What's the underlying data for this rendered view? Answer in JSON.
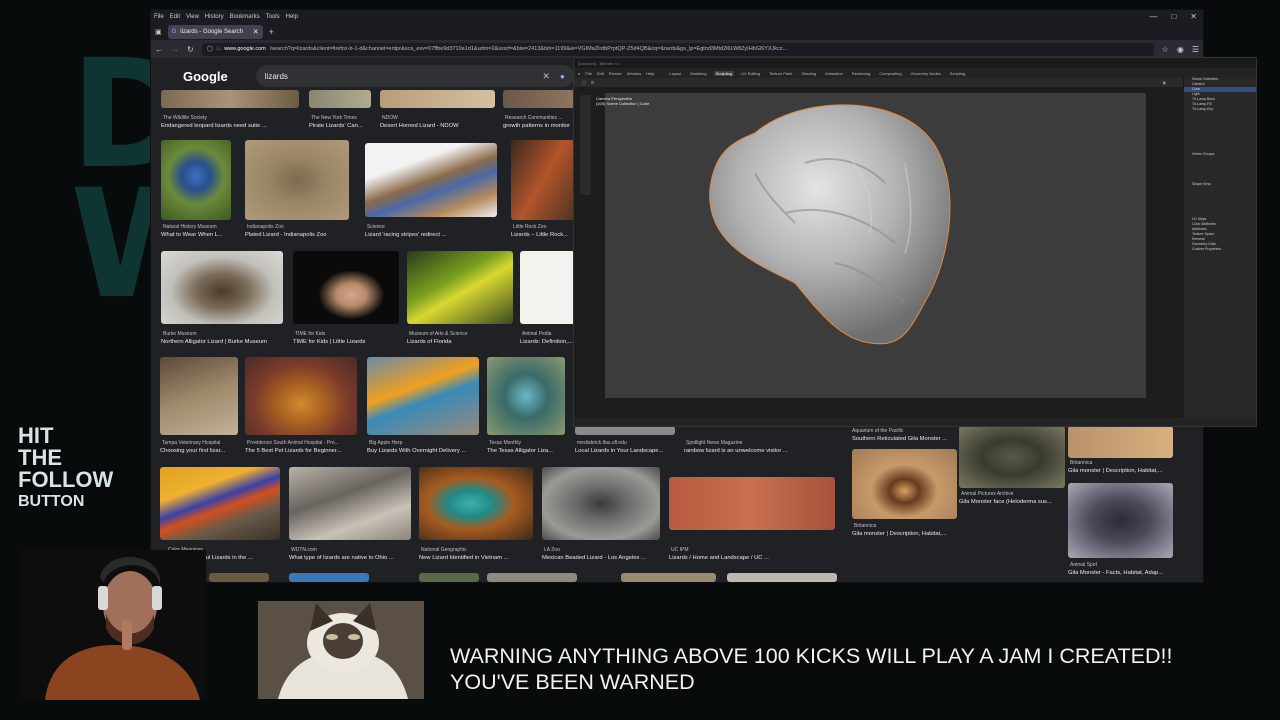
{
  "overlay": {
    "follow_lines": [
      "HIT",
      "THE",
      "FOLLOW",
      "BUTTON"
    ],
    "warning_line1": "WARNING ANYTHING ABOVE 100 KICKS WILL PLAY A JAM I CREATED!!",
    "warning_line2": "YOU'VE BEEN WARNED"
  },
  "browser": {
    "menu": [
      "File",
      "Edit",
      "View",
      "History",
      "Bookmarks",
      "Tools",
      "Help"
    ],
    "tab_label": "lizards - Google Search",
    "url_host": "www.google.com",
    "url_rest": "/search?q=lizards&client=firefox-b-1-d&channel=entpr&sca_esv=07ffbe9d3710a1d1&udm=2&sxsrf=&biw=2413&bih=1199&ei=VGtMaZlrdbPrptQP-Z5d4QB&oq=lizards&gs_lp=Egtnd3Mtd2l6LWltZyIHbGl6YXJkcz...",
    "search_query": "lizards",
    "logo": "Google"
  },
  "results": [
    {
      "source": "The Wildlife Society",
      "title": "Endangered leopard lizards need suite ..."
    },
    {
      "source": "The New York Times",
      "title": "Pirate Lizards' Can..."
    },
    {
      "source": "NDOW",
      "title": "Desert Horned Lizard - NDOW"
    },
    {
      "source": "Research Communities ...",
      "title": "growth patterns in monitor"
    },
    {
      "source": "Natural History Museum",
      "title": "What to Wear When L..."
    },
    {
      "source": "Indianapolis Zoo",
      "title": "Plated Lizard - Indianapolis Zoo"
    },
    {
      "source": "Science",
      "title": "Lizard 'racing stripes' redirect ..."
    },
    {
      "source": "Little Rock Zoo",
      "title": "Lizards – Little Rock..."
    },
    {
      "source": "Burke Museum",
      "title": "Northern Alligator Lizard | Burke Museum"
    },
    {
      "source": "TIME for Kids",
      "title": "TIME for Kids | Little Lizards"
    },
    {
      "source": "Museum of Arts & Science",
      "title": "Lizards of Florida"
    },
    {
      "source": "Animal Pedia",
      "title": "Lizards: Definition,..."
    },
    {
      "source": "Tampa Veterinary Hospital",
      "title": "Choosing your first lizar..."
    },
    {
      "source": "Providence South Animal Hospital - Pro...",
      "title": "The 5 Best Pet Lizards for Beginner..."
    },
    {
      "source": "Big Apple Herp",
      "title": "Buy Lizards With Overnight Delivery ..."
    },
    {
      "source": "Texas Monthly",
      "title": "The Texas Alligator Liza..."
    },
    {
      "source": "mediabrick.ifas.ufl.edu",
      "title": "Local Lizards in Your Landscape..."
    },
    {
      "source": "Spotlight News Magazine",
      "title": "rainbow lizard is an unwelcome visitor ..."
    },
    {
      "source": "Aquarium of the Pacific",
      "title": "Southern Reticulated Gila Monster ..."
    },
    {
      "source": "Britannica",
      "title": "Gila monster | Description, Habitat,..."
    },
    {
      "source": "Color Meanings",
      "title": "of the Most Colorful Lizards in the ..."
    },
    {
      "source": "WDTN.com",
      "title": "What type of lizards are native to Ohio ..."
    },
    {
      "source": "National Geographic",
      "title": "New Lizard Identified in Vietnam ..."
    },
    {
      "source": "LA Zoo",
      "title": "Mexican Beaded Lizard - Los Angeles ..."
    },
    {
      "source": "UC IPM",
      "title": "Lizards / Home and Landscape / UC ..."
    },
    {
      "source": "Animal Pictures Archive",
      "title": "Gila Monster face (Heloderma sus..."
    },
    {
      "source": "Britannica",
      "title": "Gila monster | Description, Habitat,..."
    },
    {
      "source": "Animal Spot",
      "title": "Gila Monster - Facts, Habitat, Adap..."
    }
  ],
  "blender": {
    "titlebar": "[Unsaved] - Blender 4.x",
    "menu": [
      "File",
      "Edit",
      "Render",
      "Window",
      "Help"
    ],
    "workspaces": [
      "Layout",
      "Modeling",
      "Sculpting",
      "UV Editing",
      "Texture Paint",
      "Shading",
      "Animation",
      "Rendering",
      "Compositing",
      "Geometry Nodes",
      "Scripting"
    ],
    "active_workspace": "Sculpting",
    "view_label": "Camera Perspective",
    "collection_label": "(100) Scene Collection | Cube",
    "outliner": [
      "Scene Collection",
      "Camera",
      "Cube",
      "Light",
      "Tri-Lamp-Back",
      "Tri-Lamp-Fill",
      "Tri-Lamp-Key"
    ],
    "properties": [
      "Vertex Groups",
      "Shape Keys",
      "UV Maps",
      "Color Attributes",
      "Attributes",
      "Texture Space",
      "Remesh",
      "Geometry Data",
      "Custom Properties"
    ]
  },
  "colors": {
    "accent": "#8ab4f8",
    "select_outline": "#e08a3c",
    "bg_teal": "#0f3532"
  }
}
